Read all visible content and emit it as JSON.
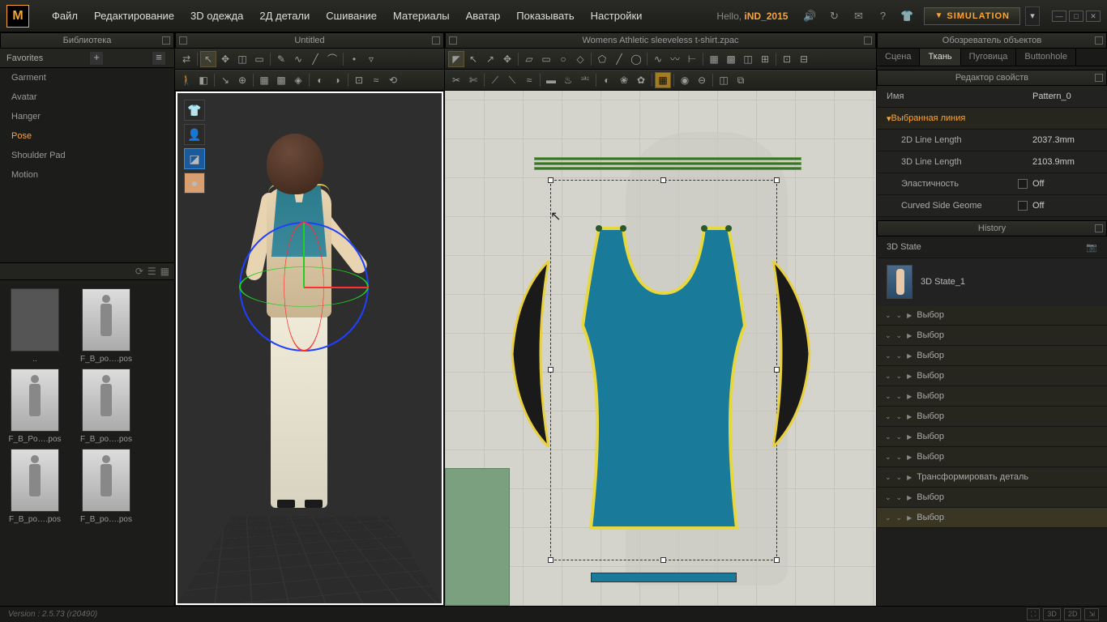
{
  "menubar": {
    "items": [
      "Файл",
      "Редактирование",
      "3D одежда",
      "2Д детали",
      "Сшивание",
      "Материалы",
      "Аватар",
      "Показывать",
      "Настройки"
    ],
    "greeting_prefix": "Hello, ",
    "username": "iND_2015",
    "simulation_label": "SIMULATION"
  },
  "library": {
    "title": "Библиотека",
    "favorites_label": "Favorites",
    "items": [
      "Garment",
      "Avatar",
      "Hanger",
      "Pose",
      "Shoulder Pad",
      "Motion"
    ],
    "selected_index": 3,
    "thumbs": [
      {
        "label": "..",
        "folder": true
      },
      {
        "label": "F_B_po….pos"
      },
      {
        "label": "F_B_Po….pos"
      },
      {
        "label": "F_B_po….pos"
      },
      {
        "label": "F_B_po….pos"
      },
      {
        "label": "F_B_po….pos"
      }
    ]
  },
  "view3d": {
    "title": "Untitled"
  },
  "view2d": {
    "title": "Womens Athletic sleeveless t-shirt.zpac"
  },
  "object_browser": {
    "title": "Обозреватель объектов",
    "tabs": [
      "Сцена",
      "Ткань",
      "Пуговица",
      "Buttonhole"
    ],
    "selected_tab": 1
  },
  "property_editor": {
    "title": "Редактор свойств",
    "rows": [
      {
        "k": "Имя",
        "v": "Pattern_0"
      }
    ],
    "section": "Выбранная линия",
    "section_rows": [
      {
        "k": "2D Line Length",
        "v": "2037.3mm"
      },
      {
        "k": "3D Line Length",
        "v": "2103.9mm"
      },
      {
        "k": "Эластичность",
        "v": "Off",
        "chk": true
      },
      {
        "k": "Curved Side Geome",
        "v": "Off",
        "chk": true
      }
    ]
  },
  "history": {
    "title": "History",
    "state_label": "3D State",
    "state_item": "3D State_1",
    "items": [
      "Выбор",
      "Выбор",
      "Выбор",
      "Выбор",
      "Выбор",
      "Выбор",
      "Выбор",
      "Выбор",
      "Трансформировать деталь",
      "Выбор",
      "Выбор"
    ]
  },
  "status": {
    "version": "Version : 2.5.73    (r20490)",
    "modes": [
      "⛶",
      "3D",
      "2D",
      "⇲"
    ]
  }
}
